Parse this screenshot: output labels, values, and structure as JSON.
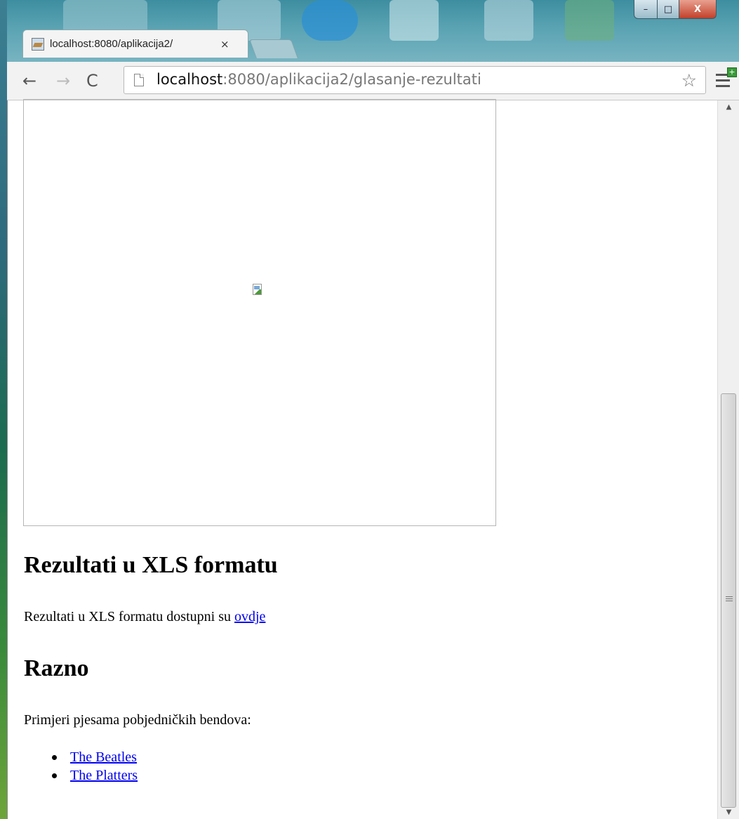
{
  "browser": {
    "tab_title": "localhost:8080/aplikacija2/",
    "tab_close": "×",
    "url_host": "localhost",
    "url_path": ":8080/aplikacija2/glasanje-rezultati",
    "window_controls": {
      "minimize": "–",
      "maximize": "□",
      "close": "X"
    },
    "nav": {
      "back": "←",
      "forward": "→",
      "reload": "C"
    },
    "star": "☆",
    "menu_badge": "+"
  },
  "page": {
    "chart_image": {
      "state": "broken-image",
      "icon": "broken-image-icon"
    },
    "xls_section": {
      "heading": "Rezultati u XLS formatu",
      "text": "Rezultati u XLS formatu dostupni su ",
      "link": "ovdje"
    },
    "misc_section": {
      "heading": "Razno",
      "text": "Primjeri pjesama pobjedničkih bendova:",
      "links": [
        "The Beatles",
        "The Platters"
      ]
    }
  },
  "scrollbar": {
    "up": "▲",
    "down": "▼"
  },
  "colors": {
    "link": "#0000ee",
    "titlebar": "#5aa3b3",
    "toolbar": "#f2f2f2"
  }
}
